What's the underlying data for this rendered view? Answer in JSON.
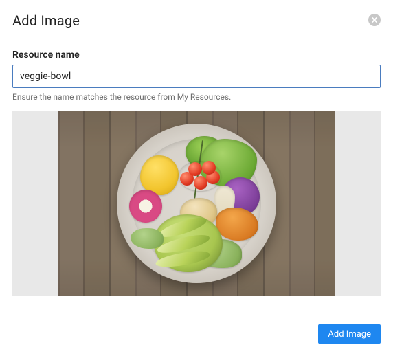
{
  "modal": {
    "title": "Add Image"
  },
  "form": {
    "resource_name_label": "Resource name",
    "resource_name_value": "veggie-bowl",
    "help_text": "Ensure the name matches the resource from My Resources."
  },
  "preview": {
    "semantic_description": "veggie-bowl",
    "alt": "A ceramic bowl on a rustic wood surface filled with colorful vegetables: sliced avocado, cherry tomatoes on the vine, yellow bell pepper, green lettuce, purple cabbage, roasted sweet potato cubes, chickpeas, watermelon radish, microgreens, and a drizzle of dressing."
  },
  "actions": {
    "submit_label": "Add Image"
  },
  "colors": {
    "accent": "#1e87f0",
    "input_border_focus": "#4a7cbf",
    "muted_text": "#6e6e6e"
  }
}
